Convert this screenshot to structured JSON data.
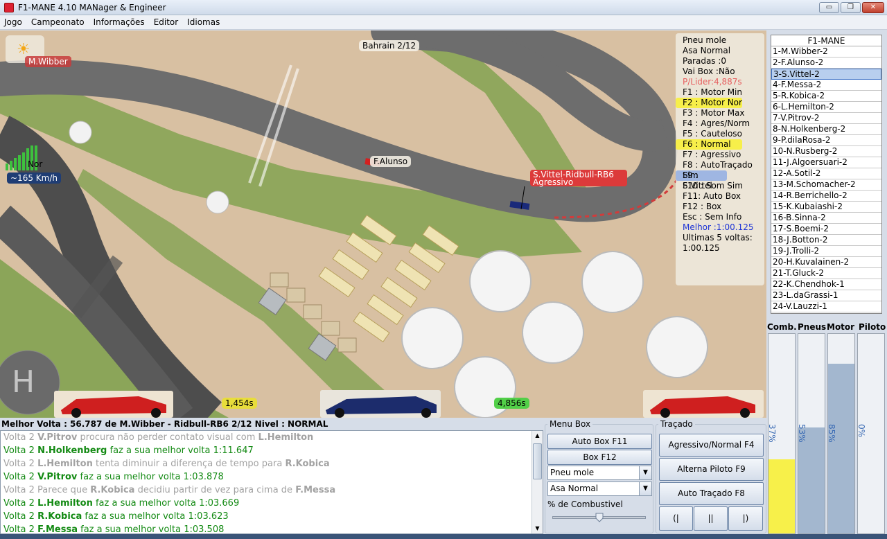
{
  "window": {
    "title": "F1-MANE 4.10 MANager & Engineer",
    "buttons": {
      "minimize": "▭",
      "restore": "❐",
      "close": "✕"
    }
  },
  "menu": [
    "Jogo",
    "Campeonato",
    "Informações",
    "Editor",
    "Idiomas"
  ],
  "track": {
    "race_label": "Bahrain 2/12",
    "weather_icon": "sun-icon",
    "driver_tags": {
      "wibber": "M.Wibber",
      "alunso": "F.Alunso",
      "vittel_line1": "S.Vittel-Ridbull-RB6",
      "vittel_line2": "Agressivo"
    },
    "signal_label": "Nor",
    "speed": "~165 Km/h",
    "gap_left": "1,454s",
    "gap_right": "4,856s",
    "helipad_letter": "H"
  },
  "info_panel": {
    "lines": [
      "Pneu mole",
      "Asa Normal",
      "Paradas :0",
      "Vai Box :Não",
      "P/Lider:4,887s",
      "F1 : Motor Min",
      "F2 : Motor Nor",
      "F3 : Motor Max",
      "F4 : Agres/Norm",
      "F5 : Cauteloso",
      "F6 : Normal",
      "F7 : Agressivo",
      "F8 : AutoTraçado Sim",
      "F9 : S.Vittel",
      "F10 : Som Sim",
      "F11: Auto Box",
      "F12 : Box",
      "Esc : Sem Info",
      "Melhor :1:00.125",
      "Ultimas 5 voltas:",
      "1:00.125"
    ]
  },
  "standings": {
    "header": "F1-MANE",
    "rows": [
      "1-M.Wibber-2",
      "2-F.Alunso-2",
      "3-S.Vittel-2",
      "4-F.Messa-2",
      "5-R.Kobica-2",
      "6-L.Hemilton-2",
      "7-V.Pitrov-2",
      "8-N.Holkenberg-2",
      "9-P.dilaRosa-2",
      "10-N.Rusberg-2",
      "11-J.Algoersuari-2",
      "12-A.Sotil-2",
      "13-M.Schomacher-2",
      "14-R.Berrichello-2",
      "15-K.Kubaiashi-2",
      "16-B.Sinna-2",
      "17-S.Boemi-2",
      "18-J.Botton-2",
      "19-J.Trolli-2",
      "20-H.Kuvalainen-2",
      "21-T.Gluck-2",
      "22-K.Chendhok-1",
      "23-L.daGrassi-1",
      "24-V.Lauzzi-1"
    ],
    "selected_index": 2
  },
  "gauges": {
    "headers": [
      "Comb.",
      "Pneus",
      "Motor",
      "Piloto"
    ],
    "values": [
      "37%",
      "53%",
      "85%",
      "0%"
    ],
    "levels": [
      0.37,
      0.53,
      0.85,
      0.0
    ],
    "colors": [
      "#f7f04a",
      "#a3b7cf",
      "#a3b7cf",
      "#a3b7cf"
    ]
  },
  "status_line": "Melhor Volta : 56.787 de M.Wibber - Ridbull-RB6 2/12 Nivel : NORMAL",
  "log": [
    {
      "cls": "gray",
      "parts": [
        [
          "Volta 2 ",
          0
        ],
        [
          "V.Pitrov",
          1
        ],
        [
          " procura não perder contato visual com ",
          0
        ],
        [
          "L.Hemilton",
          1
        ]
      ]
    },
    {
      "cls": "green",
      "parts": [
        [
          "Volta 2 ",
          0
        ],
        [
          "N.Holkenberg",
          1
        ],
        [
          " faz a sua melhor volta 1:11.647",
          0
        ]
      ]
    },
    {
      "cls": "gray",
      "parts": [
        [
          "Volta 2 ",
          0
        ],
        [
          "L.Hemilton",
          1
        ],
        [
          " tenta diminuir a diferença de tempo para ",
          0
        ],
        [
          "R.Kobica",
          1
        ]
      ]
    },
    {
      "cls": "green",
      "parts": [
        [
          "Volta 2 ",
          0
        ],
        [
          "V.Pitrov",
          1
        ],
        [
          " faz a sua melhor volta 1:03.878",
          0
        ]
      ]
    },
    {
      "cls": "gray",
      "parts": [
        [
          "Volta 2 Parece que ",
          0
        ],
        [
          "R.Kobica",
          1
        ],
        [
          " decidiu partir de vez para cima de ",
          0
        ],
        [
          "F.Messa",
          1
        ]
      ]
    },
    {
      "cls": "green",
      "parts": [
        [
          "Volta 2 ",
          0
        ],
        [
          "L.Hemilton",
          1
        ],
        [
          " faz a sua melhor volta 1:03.669",
          0
        ]
      ]
    },
    {
      "cls": "green",
      "parts": [
        [
          "Volta 2 ",
          0
        ],
        [
          "R.Kobica",
          1
        ],
        [
          " faz a sua melhor volta 1:03.623",
          0
        ]
      ]
    },
    {
      "cls": "green",
      "parts": [
        [
          "Volta 2 ",
          0
        ],
        [
          "F.Messa",
          1
        ],
        [
          " faz a sua melhor volta 1:03.508",
          0
        ]
      ]
    }
  ],
  "menu_box": {
    "title": "Menu Box",
    "auto_box": "Auto Box F11",
    "box": "Box F12",
    "tyre_select": "Pneu mole",
    "wing_select": "Asa Normal",
    "fuel_label": "% de Combustivel",
    "fuel_level": 0.5
  },
  "tracado": {
    "title": "Traçado",
    "aggressive": "Agressivo/Normal F4",
    "alternate": "Alterna Piloto F9",
    "auto": "Auto Traçado F8",
    "left": "(|",
    "center": "||",
    "right": "|)"
  }
}
